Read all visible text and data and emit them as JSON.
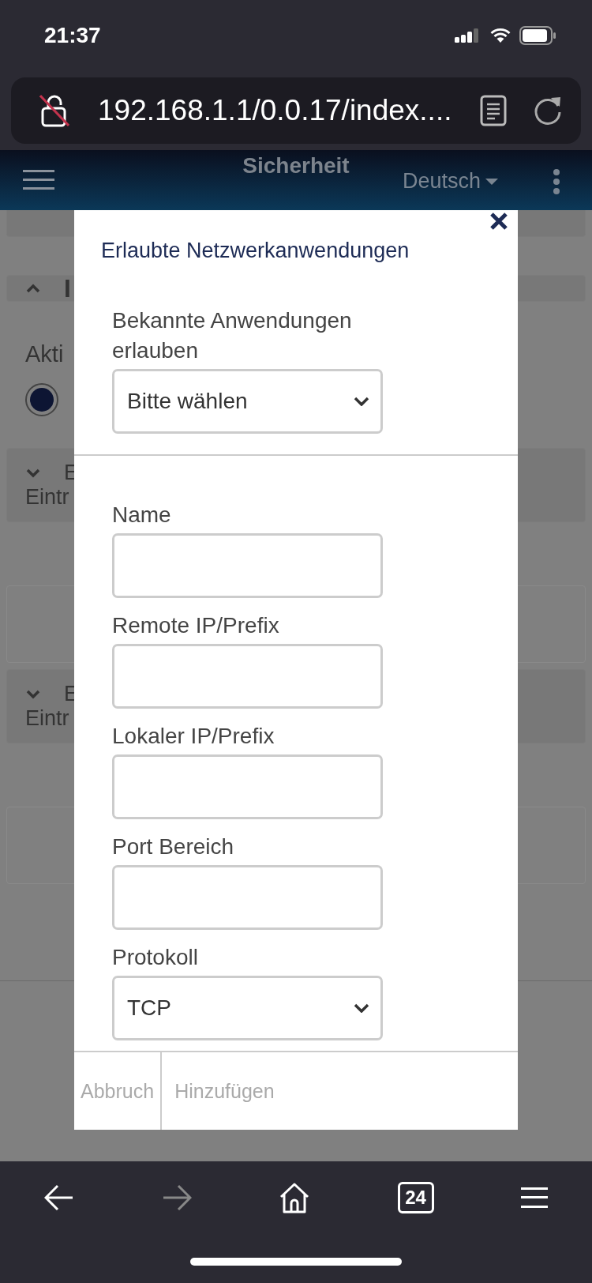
{
  "status_bar": {
    "time": "21:37"
  },
  "browser": {
    "url": "192.168.1.1/0.0.17/index....",
    "tab_count": "24"
  },
  "header": {
    "title": "Sicherheit",
    "language": "Deutsch"
  },
  "background": {
    "sections": [
      {
        "kind": "card"
      },
      {
        "kind": "card",
        "expanded": true,
        "label": "I"
      },
      {
        "kind": "radio",
        "label": "Akti",
        "selected": true
      },
      {
        "kind": "card",
        "expanded": false,
        "label": "E",
        "sublabel": "Eintr"
      },
      {
        "kind": "box"
      },
      {
        "kind": "card",
        "expanded": false,
        "label": "E",
        "sublabel": "Eintr"
      },
      {
        "kind": "box"
      }
    ]
  },
  "dialog": {
    "title": "Erlaubte Netzwerkanwendungen",
    "preset": {
      "label": "Bekannte Anwendungen erlauben",
      "value": "Bitte wählen"
    },
    "fields": [
      {
        "label": "Name"
      },
      {
        "label": "Remote IP/Prefix"
      },
      {
        "label": "Lokaler IP/Prefix"
      },
      {
        "label": "Port Bereich"
      }
    ],
    "protocol": {
      "label": "Protokoll",
      "value": "TCP"
    },
    "buttons": [
      {
        "label": "Abbruch",
        "disabled": true
      },
      {
        "label": "Hinzufügen",
        "disabled": true
      }
    ]
  }
}
